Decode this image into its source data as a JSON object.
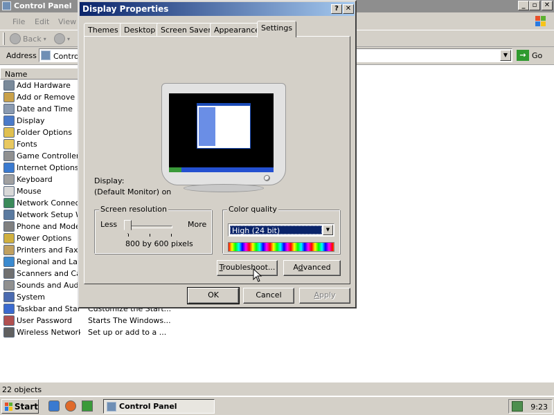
{
  "control_panel": {
    "title": "Control Panel",
    "menu": [
      "File",
      "Edit",
      "View"
    ],
    "toolbar": {
      "back_label": "Back"
    },
    "address": {
      "label": "Address",
      "value": "Control",
      "go_label": "Go"
    },
    "column_header": "Name",
    "items": [
      {
        "name": "Add Hardware",
        "description": "",
        "icon_color": "#7a8a9a"
      },
      {
        "name": "Add or Remove P...",
        "description": "",
        "icon_color": "#c9a14a"
      },
      {
        "name": "Date and Time",
        "description": "",
        "icon_color": "#8a9ab0"
      },
      {
        "name": "Display",
        "description": "",
        "icon_color": "#4a7ac9"
      },
      {
        "name": "Folder Options",
        "description": "",
        "icon_color": "#e0c050"
      },
      {
        "name": "Fonts",
        "description": "",
        "icon_color": "#e8c860"
      },
      {
        "name": "Game Controllers",
        "description": "",
        "icon_color": "#909090"
      },
      {
        "name": "Internet Options",
        "description": "",
        "icon_color": "#3a7ad0"
      },
      {
        "name": "Keyboard",
        "description": "",
        "icon_color": "#a0a0a0"
      },
      {
        "name": "Mouse",
        "description": "",
        "icon_color": "#d8d8d8"
      },
      {
        "name": "Network Connect...",
        "description": "",
        "icon_color": "#3a8a5a"
      },
      {
        "name": "Network Setup W...",
        "description": "",
        "icon_color": "#5a7aa0"
      },
      {
        "name": "Phone and Mode...",
        "description": "",
        "icon_color": "#808080"
      },
      {
        "name": "Power Options",
        "description": "",
        "icon_color": "#d0b040"
      },
      {
        "name": "Printers and Faxes",
        "description": "",
        "icon_color": "#c0a060"
      },
      {
        "name": "Regional and Lan...",
        "description": "",
        "icon_color": "#3a8ad0"
      },
      {
        "name": "Scanners and Ca...",
        "description": "",
        "icon_color": "#707070"
      },
      {
        "name": "Sounds and Audi...",
        "description": "",
        "icon_color": "#909090"
      },
      {
        "name": "System",
        "description": "",
        "icon_color": "#4a6ab0"
      },
      {
        "name": "Taskbar and Star...",
        "description": "Customize the Start...",
        "icon_color": "#3a6ad0"
      },
      {
        "name": "User Password",
        "description": "Starts The Windows...",
        "icon_color": "#b05050"
      },
      {
        "name": "Wireless Network...",
        "description": "Set up or add to a ...",
        "icon_color": "#606060"
      }
    ],
    "status": "22 objects"
  },
  "taskbar": {
    "start_label": "Start",
    "task_label": "Control Panel",
    "clock": "9:23"
  },
  "dialog": {
    "title": "Display Properties",
    "tabs": [
      "Themes",
      "Desktop",
      "Screen Saver",
      "Appearance",
      "Settings"
    ],
    "active_tab": "Settings",
    "display_label": "Display:",
    "display_value": "(Default Monitor) on",
    "resolution": {
      "legend": "Screen resolution",
      "less": "Less",
      "more": "More",
      "value_text": "800 by 600 pixels",
      "slider_position": 0
    },
    "color_quality": {
      "legend": "Color quality",
      "selected": "High (24 bit)"
    },
    "buttons": {
      "troubleshoot": "Troubleshoot...",
      "advanced": "Advanced",
      "ok": "OK",
      "cancel": "Cancel",
      "apply": "Apply"
    }
  },
  "colors": {
    "title_active_start": "#0a246a",
    "title_active_end": "#a6caf0",
    "title_inactive": "#8e8e8e",
    "face": "#d4d0c8"
  }
}
